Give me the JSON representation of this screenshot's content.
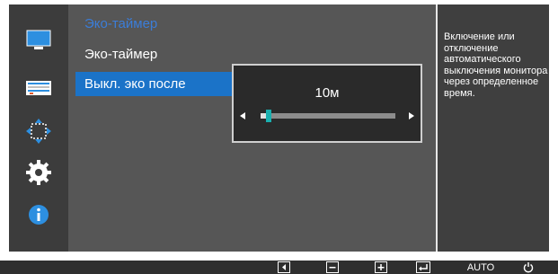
{
  "menu": {
    "title": "Эко-таймер",
    "items": [
      {
        "label": "Эко-таймер",
        "selected": false
      },
      {
        "label": "Выкл. эко после",
        "selected": true
      }
    ]
  },
  "popup": {
    "value": "10м",
    "slider_level": 0.06
  },
  "help": {
    "text": "Включение или отключение автоматического выключения монитора через определенное время."
  },
  "sidebar_icons": [
    "monitor-icon",
    "color-bars-icon",
    "arrows-icon",
    "gear-icon",
    "info-icon"
  ],
  "buttons": {
    "auto_label": "AUTO",
    "icons": [
      "left-arrow-icon",
      "minus-icon",
      "plus-icon",
      "enter-icon",
      "power-icon"
    ]
  },
  "colors": {
    "accent": "#1b73c8",
    "title": "#3b7dd8",
    "slider_thumb": "#1ab0b0"
  }
}
